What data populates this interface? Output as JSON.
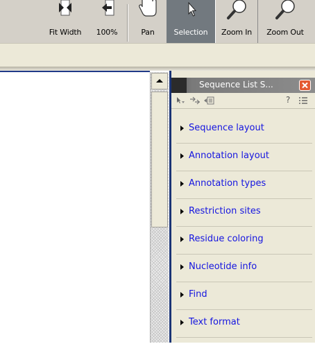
{
  "toolbar": {
    "tools": [
      {
        "label": "Fit Width",
        "icon": "fit-width-icon"
      },
      {
        "label": "100%",
        "icon": "actual-size-icon"
      },
      {
        "label": "Pan",
        "icon": "hand-icon"
      },
      {
        "label": "Selection",
        "icon": "pointer-arrow-icon",
        "selected": true
      },
      {
        "label": "Zoom In",
        "icon": "magnifier-icon"
      },
      {
        "label": "Zoom Out",
        "icon": "magnifier-icon"
      }
    ]
  },
  "panel": {
    "title": "Sequence List S...",
    "help": "?",
    "sections": [
      "Sequence layout",
      "Annotation layout",
      "Annotation types",
      "Restriction sites",
      "Residue coloring",
      "Nucleotide info",
      "Find",
      "Text format"
    ]
  },
  "colors": {
    "toolbar_bg": "#d4d0c8",
    "selected_tool_bg": "#72797f",
    "panel_bg": "#ece9d8",
    "section_link": "#1515e0",
    "panel_border": "#1c3576",
    "close_button": "#e45a32"
  }
}
